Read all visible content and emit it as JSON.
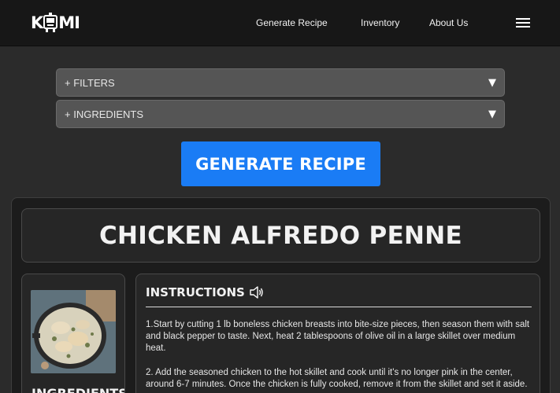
{
  "nav": {
    "logo_left": "K",
    "logo_right": "MI",
    "links": [
      "Generate Recipe",
      "Inventory",
      "About Us"
    ],
    "menu_icon": "hamburger-icon"
  },
  "filters": {
    "filters_label": "+ FILTERS",
    "ingredients_label": "+ INGREDIENTS",
    "arrow_icon": "triangle-down-icon"
  },
  "generate_button_label": "GENERATE RECIPE",
  "recipe": {
    "title": "CHICKEN ALFREDO PENNE",
    "ingredients_heading": "INGREDIENTS",
    "instructions_heading": "INSTRUCTIONS",
    "speaker_icon": "speaker-icon",
    "steps": [
      "1.Start by cutting 1 lb boneless chicken breasts into bite-size pieces, then season them with salt and black pepper to taste. Next, heat 2 tablespoons of olive oil in a large skillet over medium heat.",
      "2. Add the seasoned chicken to the hot skillet and cook until it's no longer pink in the center, around 6-7 minutes. Once the chicken is fully cooked, remove it from the skillet and set it aside."
    ]
  },
  "colors": {
    "navbar_bg": "#171717",
    "page_bg": "#2b2b2b",
    "accent_blue": "#1a7cf5",
    "dropdown_bg": "#555555"
  }
}
